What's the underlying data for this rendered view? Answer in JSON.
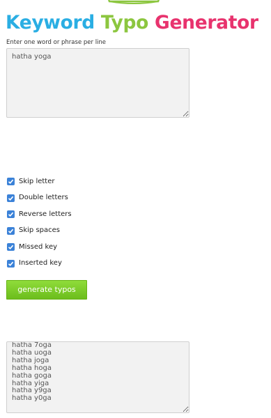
{
  "header": {
    "title_part1": "Keyword",
    "title_part2": "Typo",
    "title_part3": "Generator",
    "colors": {
      "part1": "#2aaee3",
      "part2": "#8cc63f",
      "part3": "#e8336e"
    }
  },
  "input": {
    "label": "Enter one word or phrase per line",
    "value": "hatha yoga"
  },
  "options": [
    {
      "label": "Skip letter",
      "checked": true
    },
    {
      "label": "Double letters",
      "checked": true
    },
    {
      "label": "Reverse letters",
      "checked": true
    },
    {
      "label": "Skip spaces",
      "checked": true
    },
    {
      "label": "Missed key",
      "checked": true
    },
    {
      "label": "Inserted key",
      "checked": true
    }
  ],
  "checkbox_color": "#3b82d8",
  "button": {
    "label": "generate typos",
    "color": "#7ccc28"
  },
  "output": {
    "value": "hatha 7oga\nhatha uoga\nhatha joga\nhatha hoga\nhatha goga\nhatha yiga\nhatha y9ga\nhatha y0ga"
  }
}
